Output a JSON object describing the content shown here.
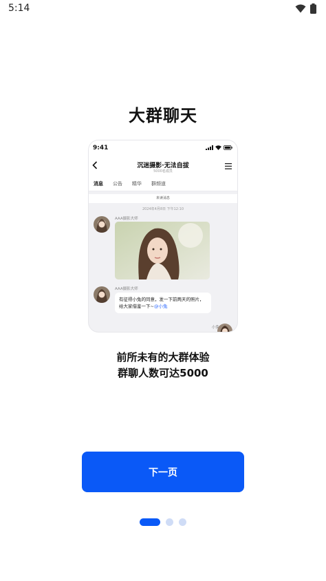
{
  "status_bar": {
    "time": "5:14",
    "icons": [
      "wifi-icon",
      "battery-icon"
    ]
  },
  "headline": "大群聊天",
  "preview": {
    "time": "9:41",
    "title": "沉迷摄影·无法自拔",
    "subtitle": "5000名成员",
    "tabs": [
      "消息",
      "公告",
      "精华",
      "群频道"
    ],
    "unread_label": "未读消息",
    "timestamp": "2024年4月8日 下午12:10",
    "messages": [
      {
        "sender": "AAA摄影大师",
        "type": "image"
      },
      {
        "sender": "AAA摄影大师",
        "type": "text",
        "text": "有征得小兔的同意，发一下前两天的照片，给大家借鉴一下~",
        "mention": "@小兔"
      }
    ],
    "self_name": "小兔"
  },
  "description": {
    "line1": "前所未有的大群体验",
    "line2": "群聊人数可达5000"
  },
  "next_button": "下一页",
  "pager": {
    "current": 1,
    "total": 3
  },
  "colors": {
    "accent": "#0a59f7",
    "dot_inactive": "#cfdcf6"
  }
}
